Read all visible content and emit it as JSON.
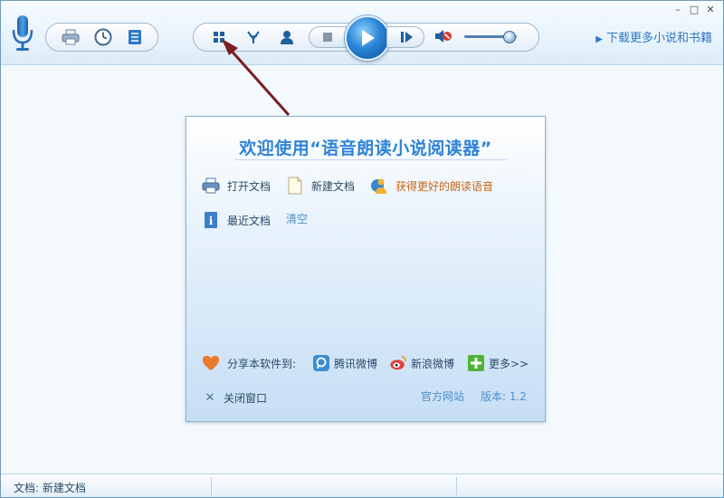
{
  "toolbar": {
    "download_link": "下载更多小说和书籍"
  },
  "dialog": {
    "title": "欢迎使用“语音朗读小说阅读器”",
    "open_doc": "打开文档",
    "new_doc": "新建文档",
    "better_voice": "获得更好的朗读语音",
    "recent_docs": "最近文档",
    "clear": "清空",
    "share_to": "分享本软件到:",
    "tencent_weibo": "腾讯微博",
    "sina_weibo": "新浪微博",
    "more": "更多>>",
    "close_window": "关闭窗口",
    "official_site": "官方网站",
    "version": "版本: 1.2"
  },
  "statusbar": {
    "document": "文档: 新建文档"
  },
  "volume": {
    "level": 0.85
  },
  "colors": {
    "accent": "#2e83d8",
    "highlight": "#c56518",
    "arrow": "#7a1e22"
  }
}
